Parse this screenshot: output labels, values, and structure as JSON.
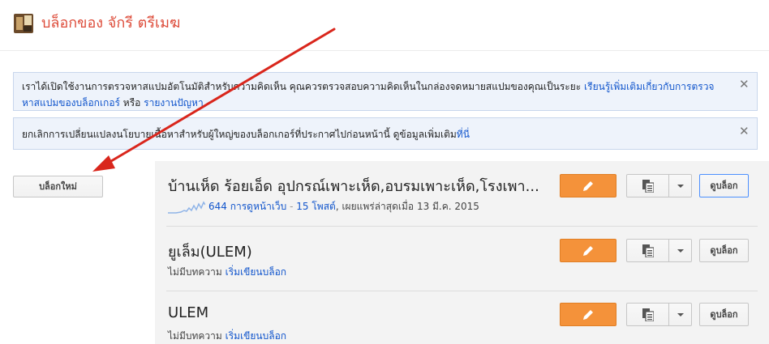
{
  "header": {
    "title": "บล็อกของ จักรี ตรีเมฆ"
  },
  "notices": [
    {
      "text": "เราได้เปิดใช้งานการตรวจหาสแปมอัตโนมัติสำหรับความคิดเห็น คุณควรตรวจสอบความคิดเห็นในกล่องจดหมายสแปมของคุณเป็นระยะ ",
      "link1": "เรียนรู้เพิ่มเติมเกี่ยวกับการตรวจหาสแปมของบล็อกเกอร์",
      "middle": " หรือ ",
      "link2": "รายงานปัญหา",
      "close": "✕"
    },
    {
      "text": "ยกเลิกการเปลี่ยนแปลงนโยบายเนื้อหาสำหรับผู้ใหญ่ของบล็อกเกอร์ที่ประกาศไปก่อนหน้านี้ ดูข้อมูลเพิ่มเติม",
      "link1": "ที่นี่",
      "close": "✕"
    }
  ],
  "sidebar": {
    "new_blog_label": "บล็อกใหม่"
  },
  "blogs": [
    {
      "name": "บ้านเห็ด ร้อยเอ็ด อุปกรณ์เพาะเห็ด,อบรมเพาะเห็ด,โรงเพา...",
      "pageviews": "644 การดูหน้าเว็บ",
      "sep": " - ",
      "posts": "15 โพสต์",
      "published": ", เผยแพร่ล่าสุดเมื่อ 13 มี.ค. 2015",
      "view_label": "ดูบล็อก"
    },
    {
      "name": "ยูเล็ม(ULEM)",
      "no_posts": "ไม่มีบทความ",
      "start_link": "เริ่มเขียนบล็อก",
      "view_label": "ดูบล็อก"
    },
    {
      "name": "ULEM",
      "no_posts": "ไม่มีบทความ",
      "start_link": "เริ่มเขียนบล็อก",
      "view_label": "ดูบล็อก"
    }
  ],
  "colors": {
    "accent": "#dd4b39",
    "edit_button": "#f4923a",
    "link": "#1155cc",
    "annotation_arrow": "#d9261c"
  },
  "icons": {
    "edit": "pencil-icon",
    "posts": "documents-icon",
    "dropdown": "chevron-down-icon",
    "close": "close-icon"
  }
}
